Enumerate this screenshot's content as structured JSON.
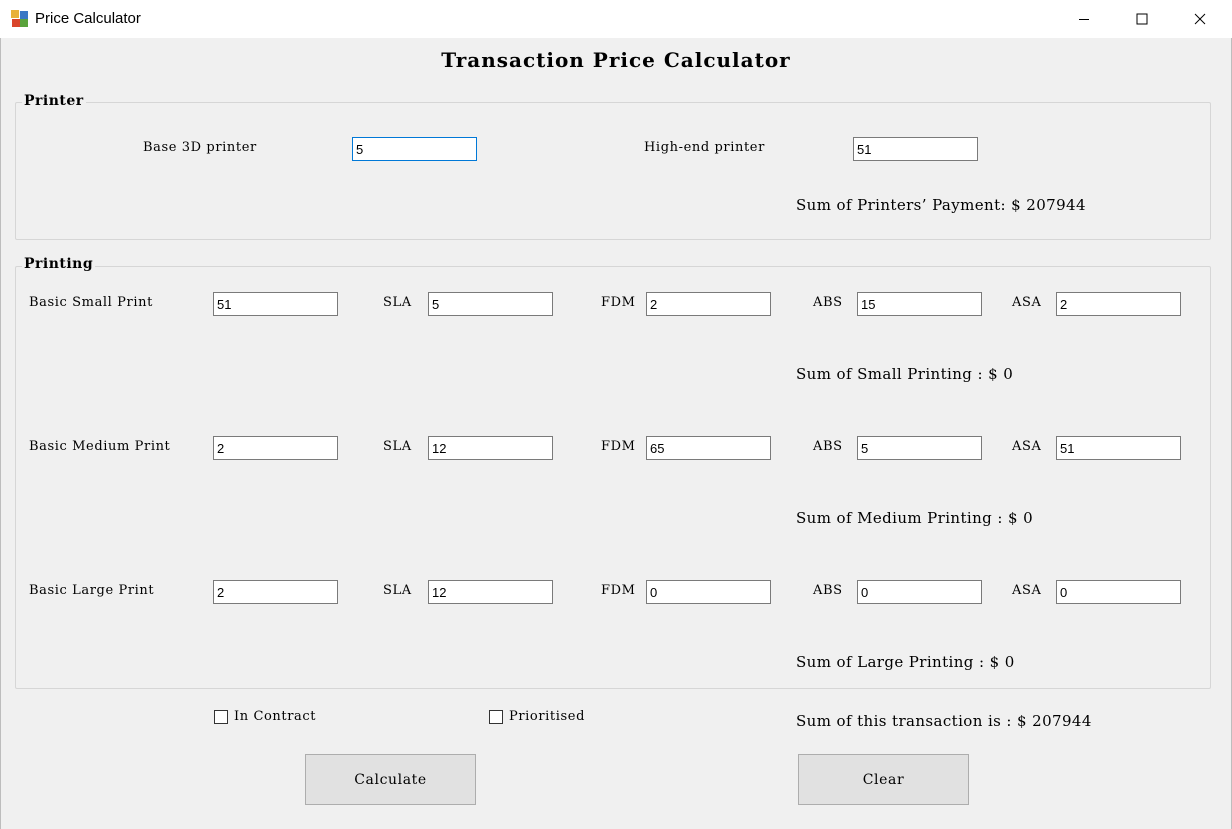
{
  "window": {
    "title": "Price Calculator"
  },
  "heading": "Transaction Price Calculator",
  "printer": {
    "group_label": "Printer",
    "base_label": "Base 3D printer",
    "base_value": "5",
    "highend_label": "High-end printer",
    "highend_value": "51",
    "sum_text": "Sum of Printers’ Payment: $ 207944"
  },
  "printing": {
    "group_label": "Printing",
    "col_labels": {
      "sla": "SLA",
      "fdm": "FDM",
      "abs": "ABS",
      "asa": "ASA"
    },
    "small": {
      "label": "Basic Small Print",
      "basic": "51",
      "sla": "5",
      "fdm": "2",
      "abs": "15",
      "asa": "2",
      "sum_text": "Sum of Small Printing : $ 0"
    },
    "medium": {
      "label": "Basic Medium Print",
      "basic": "2",
      "sla": "12",
      "fdm": "65",
      "abs": "5",
      "asa": "51",
      "sum_text": "Sum of Medium Printing : $ 0"
    },
    "large": {
      "label": "Basic Large Print",
      "basic": "2",
      "sla": "12",
      "fdm": "0",
      "abs": "0",
      "asa": "0",
      "sum_text": "Sum of Large Printing : $ 0"
    }
  },
  "options": {
    "in_contract": "In Contract",
    "prioritised": "Prioritised"
  },
  "total_text": "Sum of this transaction is : $ 207944",
  "buttons": {
    "calculate": "Calculate",
    "clear": "Clear"
  },
  "icons": {
    "app": "app-icon",
    "minimize": "minimize-icon",
    "maximize": "maximize-icon",
    "close": "close-icon"
  }
}
